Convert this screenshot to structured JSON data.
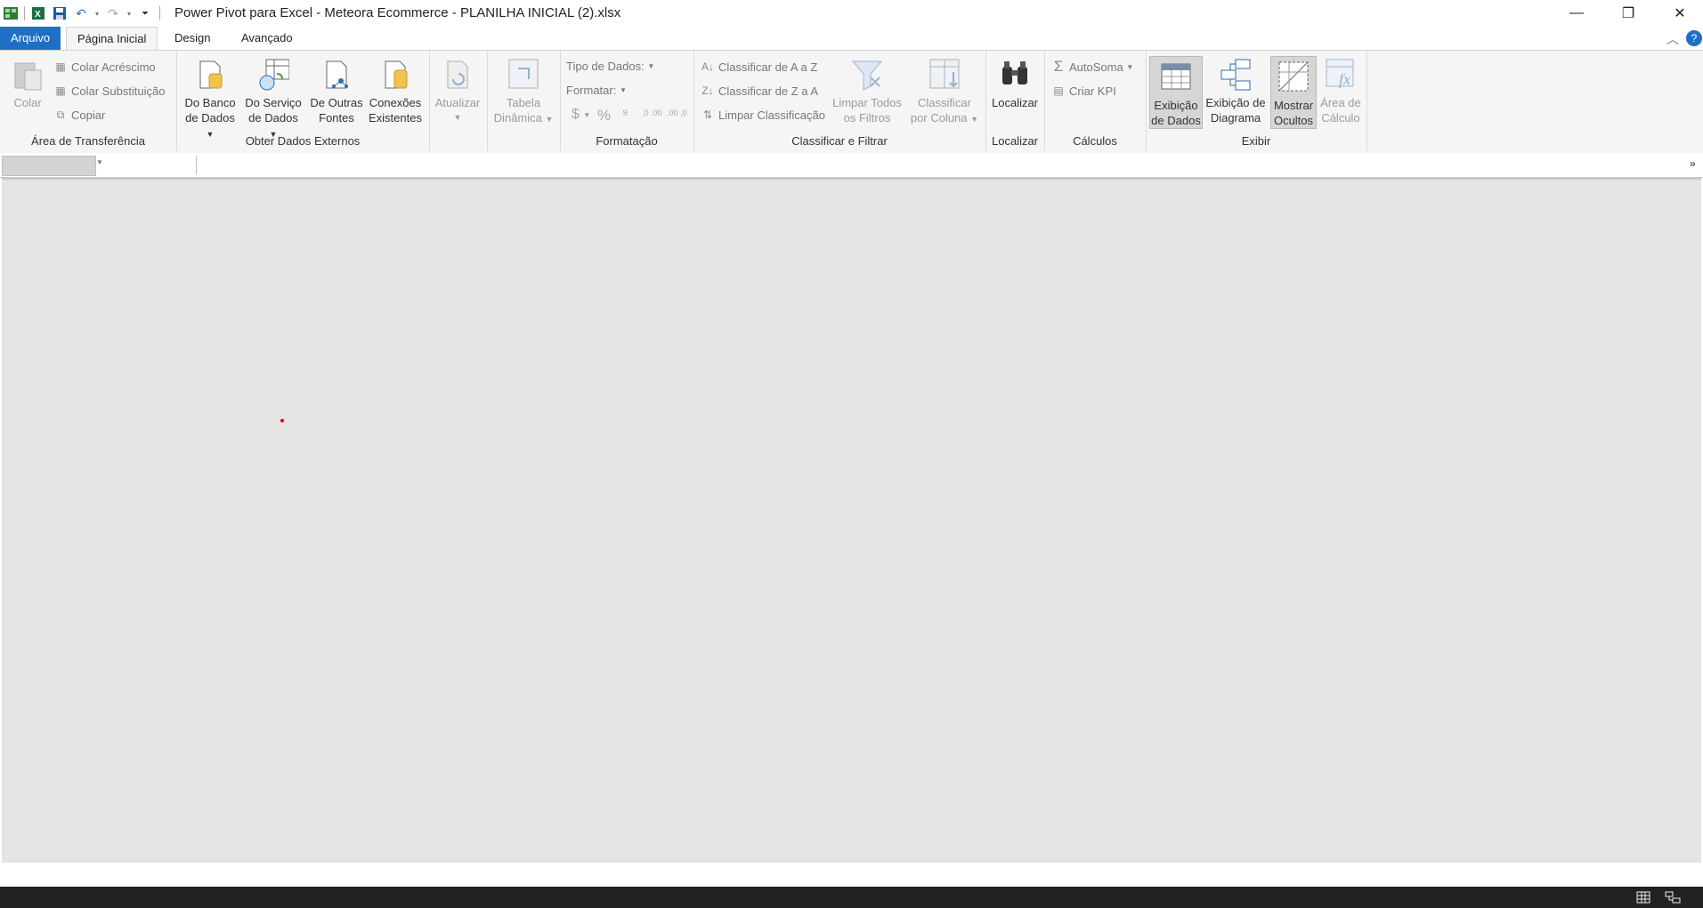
{
  "window": {
    "title": "Power Pivot para Excel - Meteora Ecommerce - PLANILHA INICIAL (2).xlsx"
  },
  "tabs": [
    {
      "label": "Arquivo"
    },
    {
      "label": "Página Inicial"
    },
    {
      "label": "Design"
    },
    {
      "label": "Avançado"
    }
  ],
  "ribbon": {
    "clipboard": {
      "group_label": "Área de Transferência",
      "paste": "Colar",
      "paste_append": "Colar Acréscimo",
      "paste_replace": "Colar Substituição",
      "copy": "Copiar"
    },
    "external": {
      "group_label": "Obter Dados Externos",
      "from_db_1": "Do Banco",
      "from_db_2": "de Dados",
      "from_service_1": "Do Serviço",
      "from_service_2": "de Dados",
      "other_1": "De Outras",
      "other_2": "Fontes",
      "existing_1": "Conexões",
      "existing_2": "Existentes"
    },
    "refresh": {
      "label": "Atualizar"
    },
    "pivot": {
      "label_1": "Tabela",
      "label_2": "Dinâmica"
    },
    "formatting": {
      "group_label": "Formatação",
      "data_type": "Tipo de Dados:",
      "format": "Formatar:",
      "currency": "$",
      "percent": "%",
      "comma": "⁹",
      "inc_dec": ",0 .00",
      "dec_dec": ".00 ,0"
    },
    "sort": {
      "group_label": "Classificar e Filtrar",
      "asc": "Classificar de A a Z",
      "desc": "Classificar de Z a A",
      "clear": "Limpar Classificação",
      "clear_filters_1": "Limpar Todos",
      "clear_filters_2": "os Filtros",
      "by_col_1": "Classificar",
      "by_col_2": "por Coluna"
    },
    "find": {
      "group_label": "Localizar",
      "label": "Localizar"
    },
    "calc": {
      "group_label": "Cálculos",
      "autosum": "AutoSoma",
      "kpi": "Criar KPI"
    },
    "view": {
      "group_label": "Exibir",
      "data_1": "Exibição",
      "data_2": "de Dados",
      "diagram_1": "Exibição de",
      "diagram_2": "Diagrama",
      "hidden_1": "Mostrar",
      "hidden_2": "Ocultos",
      "calc_area_1": "Área de",
      "calc_area_2": "Cálculo"
    }
  },
  "colors": {
    "accent": "#1f6fc5",
    "workspace": "#e4e4e4",
    "status": "#222222"
  }
}
